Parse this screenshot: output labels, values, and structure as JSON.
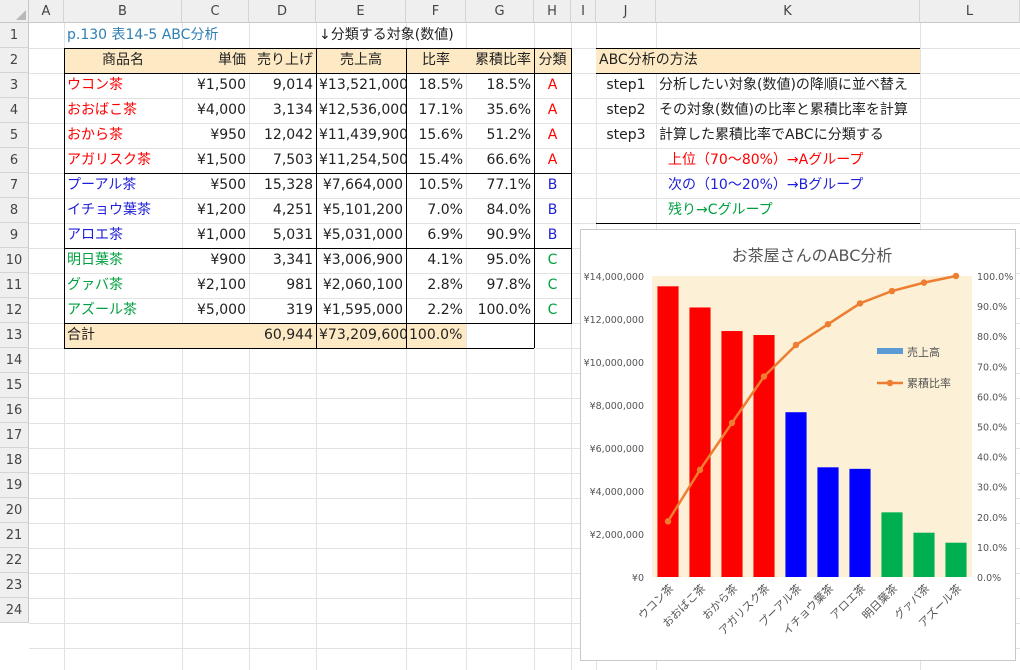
{
  "spreadsheet": {
    "columns": [
      "A",
      "B",
      "C",
      "D",
      "E",
      "F",
      "G",
      "H",
      "I",
      "J",
      "K",
      "L"
    ],
    "rows": [
      "1",
      "2",
      "3",
      "4",
      "5",
      "6",
      "7",
      "8",
      "9",
      "10",
      "11",
      "12",
      "13",
      "14",
      "15",
      "16",
      "17",
      "18",
      "19",
      "20",
      "21",
      "22",
      "23",
      "24"
    ],
    "title_cell": "p.130 表14-5 ABC分析",
    "target_note": "↓分類する対象(数値)",
    "headers": [
      "商品名",
      "単価",
      "売り上げ",
      "売上高",
      "比率",
      "累積比率",
      "分類"
    ],
    "table": [
      {
        "name": "ウコン茶",
        "price": "¥1,500",
        "units": "9,014",
        "sales": "¥13,521,000",
        "ratio": "18.5%",
        "cum": "18.5%",
        "cls": "A"
      },
      {
        "name": "おおばこ茶",
        "price": "¥4,000",
        "units": "3,134",
        "sales": "¥12,536,000",
        "ratio": "17.1%",
        "cum": "35.6%",
        "cls": "A"
      },
      {
        "name": "おから茶",
        "price": "¥950",
        "units": "12,042",
        "sales": "¥11,439,900",
        "ratio": "15.6%",
        "cum": "51.2%",
        "cls": "A"
      },
      {
        "name": "アガリスク茶",
        "price": "¥1,500",
        "units": "7,503",
        "sales": "¥11,254,500",
        "ratio": "15.4%",
        "cum": "66.6%",
        "cls": "A"
      },
      {
        "name": "プーアル茶",
        "price": "¥500",
        "units": "15,328",
        "sales": "¥7,664,000",
        "ratio": "10.5%",
        "cum": "77.1%",
        "cls": "B"
      },
      {
        "name": "イチョウ葉茶",
        "price": "¥1,200",
        "units": "4,251",
        "sales": "¥5,101,200",
        "ratio": "7.0%",
        "cum": "84.0%",
        "cls": "B"
      },
      {
        "name": "アロエ茶",
        "price": "¥1,000",
        "units": "5,031",
        "sales": "¥5,031,000",
        "ratio": "6.9%",
        "cum": "90.9%",
        "cls": "B"
      },
      {
        "name": "明日葉茶",
        "price": "¥900",
        "units": "3,341",
        "sales": "¥3,006,900",
        "ratio": "4.1%",
        "cum": "95.0%",
        "cls": "C"
      },
      {
        "name": "グァバ茶",
        "price": "¥2,100",
        "units": "981",
        "sales": "¥2,060,100",
        "ratio": "2.8%",
        "cum": "97.8%",
        "cls": "C"
      },
      {
        "name": "アズール茶",
        "price": "¥5,000",
        "units": "319",
        "sales": "¥1,595,000",
        "ratio": "2.2%",
        "cum": "100.0%",
        "cls": "C"
      }
    ],
    "total": {
      "label": "合計",
      "units": "60,944",
      "sales": "¥73,209,600",
      "ratio": "100.0%"
    },
    "method": {
      "title": "ABC分析の方法",
      "steps": [
        {
          "step": "step1",
          "text": "分析したい対象(数値)の降順に並べ替え"
        },
        {
          "step": "step2",
          "text": "その対象(数値)の比率と累積比率を計算"
        },
        {
          "step": "step3",
          "text": "計算した累積比率でABCに分類する"
        }
      ],
      "groups": [
        "上位（70〜80%）→Aグループ",
        "次の（10〜20%）→Bグループ",
        "残り→Cグループ"
      ]
    },
    "colors": {
      "A": "#ff0000",
      "B": "#1f1fd8",
      "C": "#00a040",
      "header_fill": "#fde9c4",
      "line": "#ed7d31",
      "chart_bg": "#fcf0d6"
    }
  },
  "chart_data": {
    "type": "bar",
    "title": "お茶屋さんのABC分析",
    "categories": [
      "ウコン茶",
      "おおばこ茶",
      "おから茶",
      "アガリスク茶",
      "プーアル茶",
      "イチョウ葉茶",
      "アロエ茶",
      "明日葉茶",
      "グァバ茶",
      "アズール茶"
    ],
    "series": [
      {
        "name": "売上高",
        "type": "bar",
        "axis": "left",
        "values": [
          13521000,
          12536000,
          11439900,
          11254500,
          7664000,
          5101200,
          5031000,
          3006900,
          2060100,
          1595000
        ]
      },
      {
        "name": "累積比率",
        "type": "line",
        "axis": "right",
        "values": [
          18.5,
          35.6,
          51.2,
          66.6,
          77.1,
          84.0,
          90.9,
          95.0,
          97.8,
          100.0
        ]
      }
    ],
    "bar_colors": [
      "#ff0000",
      "#ff0000",
      "#ff0000",
      "#ff0000",
      "#0000ff",
      "#0000ff",
      "#0000ff",
      "#00b050",
      "#00b050",
      "#00b050"
    ],
    "y_ticks": [
      "¥14,000,000",
      "¥12,000,000",
      "¥10,000,000",
      "¥8,000,000",
      "¥6,000,000",
      "¥4,000,000",
      "¥2,000,000",
      "¥0"
    ],
    "y2_ticks": [
      "100.0%",
      "90.0%",
      "80.0%",
      "70.0%",
      "60.0%",
      "50.0%",
      "40.0%",
      "30.0%",
      "20.0%",
      "10.0%",
      "0.0%"
    ],
    "ylim": [
      0,
      14000000
    ],
    "y2lim": [
      0,
      100
    ],
    "legend": [
      {
        "name": "売上高",
        "color": "#5b9bd5"
      },
      {
        "name": "累積比率",
        "color": "#ed7d31"
      }
    ],
    "legend_position": "right"
  }
}
